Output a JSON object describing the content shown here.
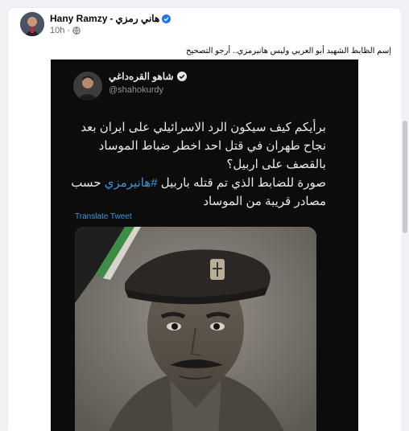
{
  "post": {
    "author_en": "Hany Ramzy",
    "separator": "-",
    "author_ar": "هاني رمزي",
    "time": "10h",
    "dot": "·",
    "text": "إسم الظابط الشهيد أبو العربي وليس هانيرمزي.. أرجو التصحيح"
  },
  "tweet": {
    "name": "شاهو القرەداغي",
    "handle": "@shahokurdy",
    "lines": [
      "برأيكم كيف سيكون الرد الاسرائيلي على ايران بعد",
      "نجاح طهران في قتل احد اخطر ضباط الموساد",
      "بالقصف على اربيل؟",
      "صورة للضابط الذي تم قتله باربيل",
      "#هانيرمزي",
      "حسب",
      "مصادر قريبة من الموساد"
    ],
    "translate_label": "Translate Tweet"
  },
  "colors": {
    "background": "#f0f2f5",
    "card": "#ffffff",
    "tweet_bg": "#0c0c0d",
    "link_blue": "#3b95e0",
    "verified_blue": "#1877f2"
  },
  "icons": {
    "verified": "verified-badge-icon",
    "globe": "globe-icon",
    "tweet_verified": "verified-badge-icon"
  }
}
